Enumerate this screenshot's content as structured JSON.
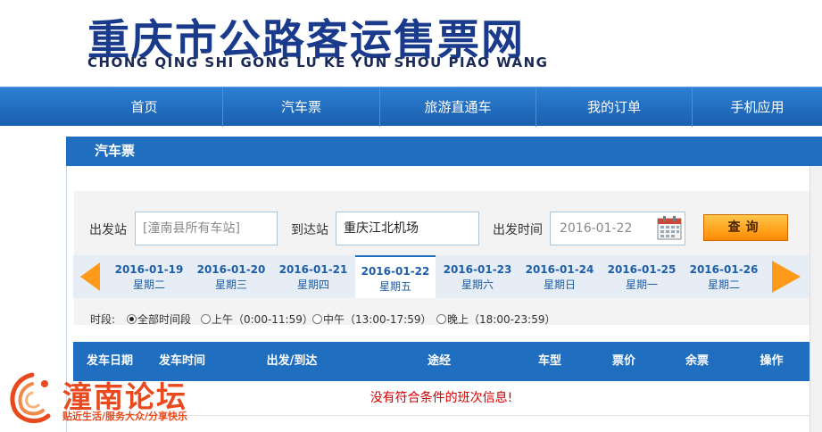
{
  "header": {
    "title_cn": "重庆市公路客运售票网",
    "title_en": "CHONG QING SHI GONG LU KE YUN SHOU PIAO WANG"
  },
  "nav": {
    "items": [
      {
        "label": "首页"
      },
      {
        "label": "汽车票"
      },
      {
        "label": "旅游直通车"
      },
      {
        "label": "我的订单"
      },
      {
        "label": "手机应用"
      }
    ]
  },
  "section": {
    "title": "汽车票"
  },
  "search": {
    "depart_label": "出发站",
    "depart_placeholder": "[潼南县所有车站]",
    "arrive_label": "到达站",
    "arrive_value": "重庆江北机场",
    "time_label": "出发时间",
    "date_placeholder": "2016-01-22",
    "query_label": "查询"
  },
  "dates": [
    {
      "date": "2016-01-19",
      "weekday": "星期二"
    },
    {
      "date": "2016-01-20",
      "weekday": "星期三"
    },
    {
      "date": "2016-01-21",
      "weekday": "星期四"
    },
    {
      "date": "2016-01-22",
      "weekday": "星期五",
      "active": true
    },
    {
      "date": "2016-01-23",
      "weekday": "星期六"
    },
    {
      "date": "2016-01-24",
      "weekday": "星期日"
    },
    {
      "date": "2016-01-25",
      "weekday": "星期一"
    },
    {
      "date": "2016-01-26",
      "weekday": "星期二"
    }
  ],
  "time_filter": {
    "label": "时段:",
    "options": [
      {
        "label": "全部时间段",
        "checked": true
      },
      {
        "label": "上午（0:00-11:59）"
      },
      {
        "label": "中午（13:00-17:59）"
      },
      {
        "label": "晚上（18:00-23:59）"
      }
    ]
  },
  "table": {
    "columns": [
      "发车日期",
      "发车时间",
      "出发/到达",
      "途经",
      "车型",
      "票价",
      "余票",
      "操作"
    ],
    "empty_message": "没有符合条件的班次信息!"
  },
  "watermark": {
    "title": "潼南论坛",
    "subtitle": "贴近生活/服务大众/分享快乐"
  },
  "colors": {
    "nav_blue": "#1b5fae",
    "title_blue": "#1a3a8c",
    "accent_orange": "#ff8a00",
    "error_red": "#d40000"
  }
}
